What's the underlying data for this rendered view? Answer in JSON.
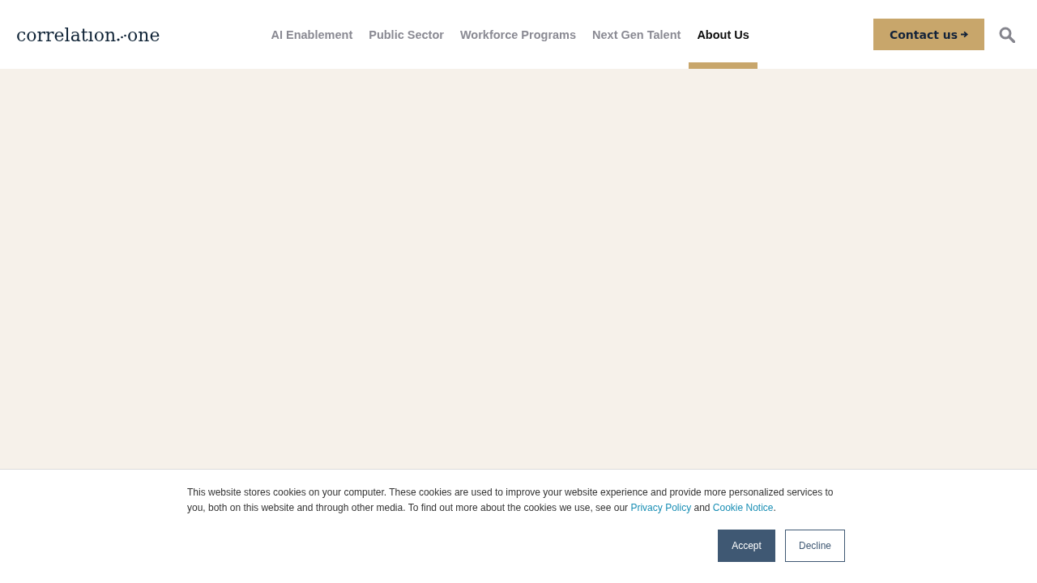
{
  "header": {
    "logo": {
      "left": "correlatıon",
      "right": "one"
    },
    "nav": [
      {
        "label": "AI Enablement",
        "selected": false
      },
      {
        "label": "Public Sector",
        "selected": false
      },
      {
        "label": "Workforce Programs",
        "selected": false
      },
      {
        "label": "Next Gen Talent",
        "selected": false
      },
      {
        "label": "About Us",
        "selected": true
      }
    ],
    "contact_button": "Contact us"
  },
  "cookie_banner": {
    "message": [
      {
        "kind": "text",
        "text": "This website stores cookies on your computer. These cookies are used to improve your website experience and provide more personalized services to you, both on this website and through other media. To find out more about the cookies we use, see our "
      },
      {
        "kind": "link",
        "text": "Privacy Policy"
      },
      {
        "kind": "text",
        "text": " and "
      },
      {
        "kind": "link",
        "text": "Cookie Notice"
      },
      {
        "kind": "text",
        "text": "."
      }
    ],
    "buttons": [
      {
        "label": "Accept",
        "kind": "primary"
      },
      {
        "label": "Decline",
        "kind": "secondary"
      }
    ]
  }
}
